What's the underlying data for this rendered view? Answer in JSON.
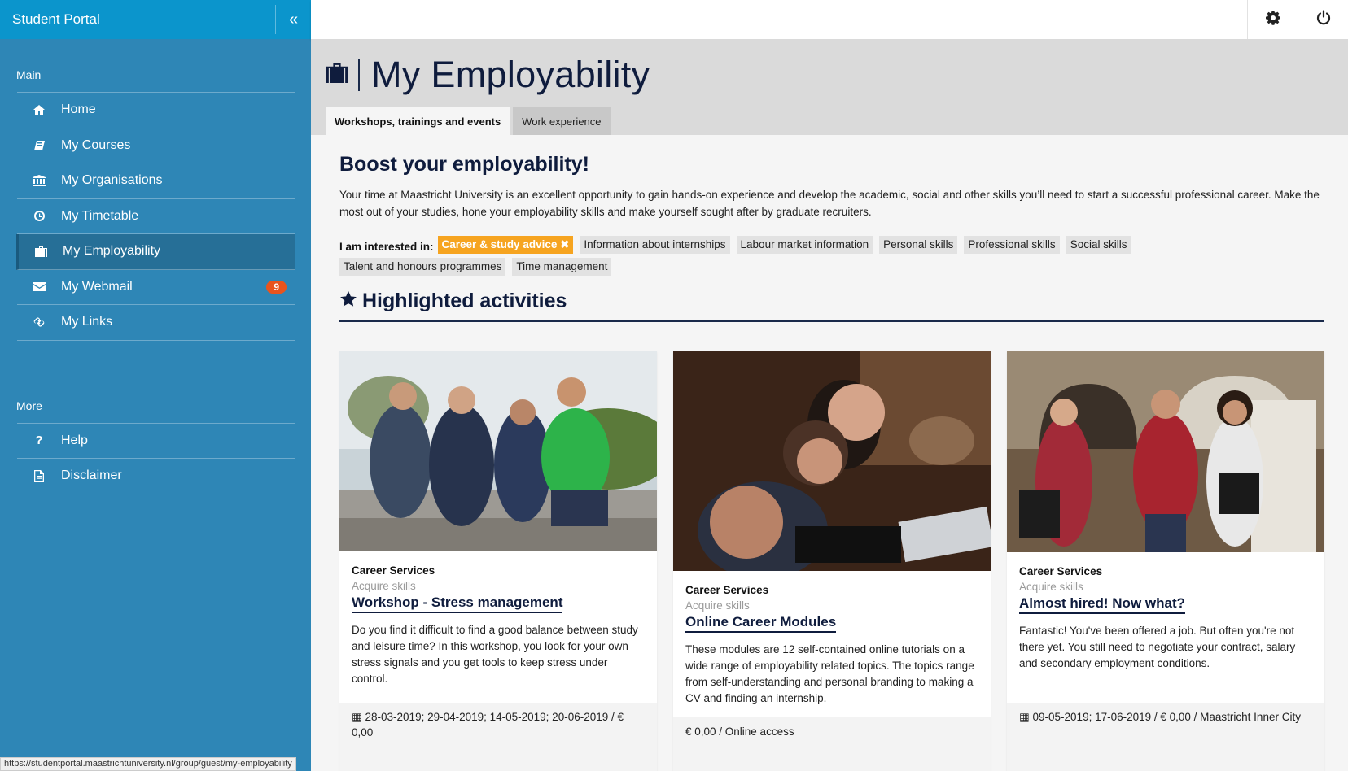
{
  "sidebar": {
    "title": "Student Portal",
    "collapse_icon": "double-chevron-left",
    "main_label": "Main",
    "more_label": "More",
    "main_items": [
      {
        "label": "Home",
        "icon": "home-icon"
      },
      {
        "label": "My Courses",
        "icon": "book-icon"
      },
      {
        "label": "My Organisations",
        "icon": "institution-icon"
      },
      {
        "label": "My Timetable",
        "icon": "clock-icon"
      },
      {
        "label": "My Employability",
        "icon": "briefcase-icon"
      },
      {
        "label": "My Webmail",
        "icon": "envelope-icon",
        "badge": "9"
      },
      {
        "label": "My Links",
        "icon": "link-icon"
      }
    ],
    "more_items": [
      {
        "label": "Help",
        "icon": "question-icon"
      },
      {
        "label": "Disclaimer",
        "icon": "document-icon"
      }
    ]
  },
  "topbar": {
    "settings_icon": "gear-icon",
    "logout_icon": "power-icon"
  },
  "page": {
    "title": "My Employability",
    "tabs": [
      "Workshops, trainings and events",
      "Work experience"
    ]
  },
  "content": {
    "heading": "Boost your employability!",
    "intro": "Your time at Maastricht University is an excellent opportunity to gain hands-on experience and develop the academic, social and other skills you’ll need to start a successful professional career. Make the most out of your studies, hone your employability skills and make yourself sought after by graduate recruiters.",
    "interest_label": "I am interested in:",
    "interests": [
      {
        "label": "Career & study advice ✖",
        "selected": true
      },
      {
        "label": "Information about internships",
        "selected": false
      },
      {
        "label": "Labour market information",
        "selected": false
      },
      {
        "label": "Personal skills",
        "selected": false
      },
      {
        "label": "Professional skills",
        "selected": false
      },
      {
        "label": "Social skills",
        "selected": false
      },
      {
        "label": "Talent and honours programmes",
        "selected": false
      },
      {
        "label": "Time management",
        "selected": false
      }
    ],
    "highlighted_title": "Highlighted activities"
  },
  "cards": [
    {
      "org": "Career Services",
      "category": "Acquire skills",
      "title": "Workshop - Stress management",
      "description": "Do you find it difficult to find a good balance between study and leisure time? In this workshop, you look for your own stress signals and you get tools to keep stress under control.",
      "footer": "28-03-2019; 29-04-2019; 14-05-2019; 20-06-2019  /  € 0,00"
    },
    {
      "org": "Career Services",
      "category": "Acquire skills",
      "title": "Online Career Modules",
      "description": "These modules are 12 self-contained online tutorials on a wide range of employability related topics. The topics range from self-understanding and personal branding to making a CV and finding an internship.",
      "footer": "€ 0,00  /   Online access"
    },
    {
      "org": "Career Services",
      "category": "Acquire skills",
      "title": "Almost hired! Now what?",
      "description": "Fantastic! You've been offered a job. But often you're not there yet. You still need to negotiate your contract, salary and secondary employment conditions.",
      "footer": "09-05-2019; 17-06-2019 / € 0,00  /   Maastricht Inner City"
    }
  ],
  "status_url": "https://studentportal.maastrichtuniversity.nl/group/guest/my-employability"
}
